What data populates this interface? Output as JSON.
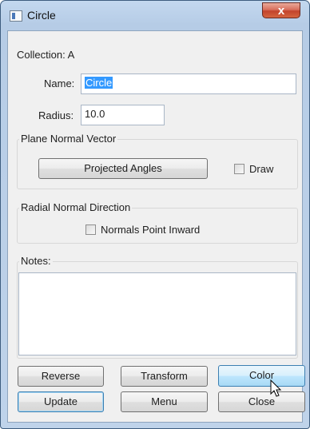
{
  "window": {
    "title": "Circle",
    "close_label": "x"
  },
  "form": {
    "collection_label": "Collection: A",
    "name_label": "Name:",
    "name_value": "Circle",
    "radius_label": "Radius:",
    "radius_value": "10.0"
  },
  "plane_normal": {
    "group_label": "Plane Normal Vector",
    "projected_angles_label": "Projected Angles",
    "draw_label": "Draw",
    "draw_checked": false
  },
  "radial_normal": {
    "group_label": "Radial Normal Direction",
    "inward_label": "Normals Point Inward",
    "inward_checked": false
  },
  "notes": {
    "group_label": "Notes:",
    "value": ""
  },
  "buttons": {
    "reverse": "Reverse",
    "transform": "Transform",
    "color": "Color",
    "update": "Update",
    "menu": "Menu",
    "close": "Close"
  },
  "colors": {
    "title_bar": "#bfd3ea",
    "close_button": "#c3442c",
    "selection": "#3399ff",
    "hover_button": "#bee6fd"
  }
}
